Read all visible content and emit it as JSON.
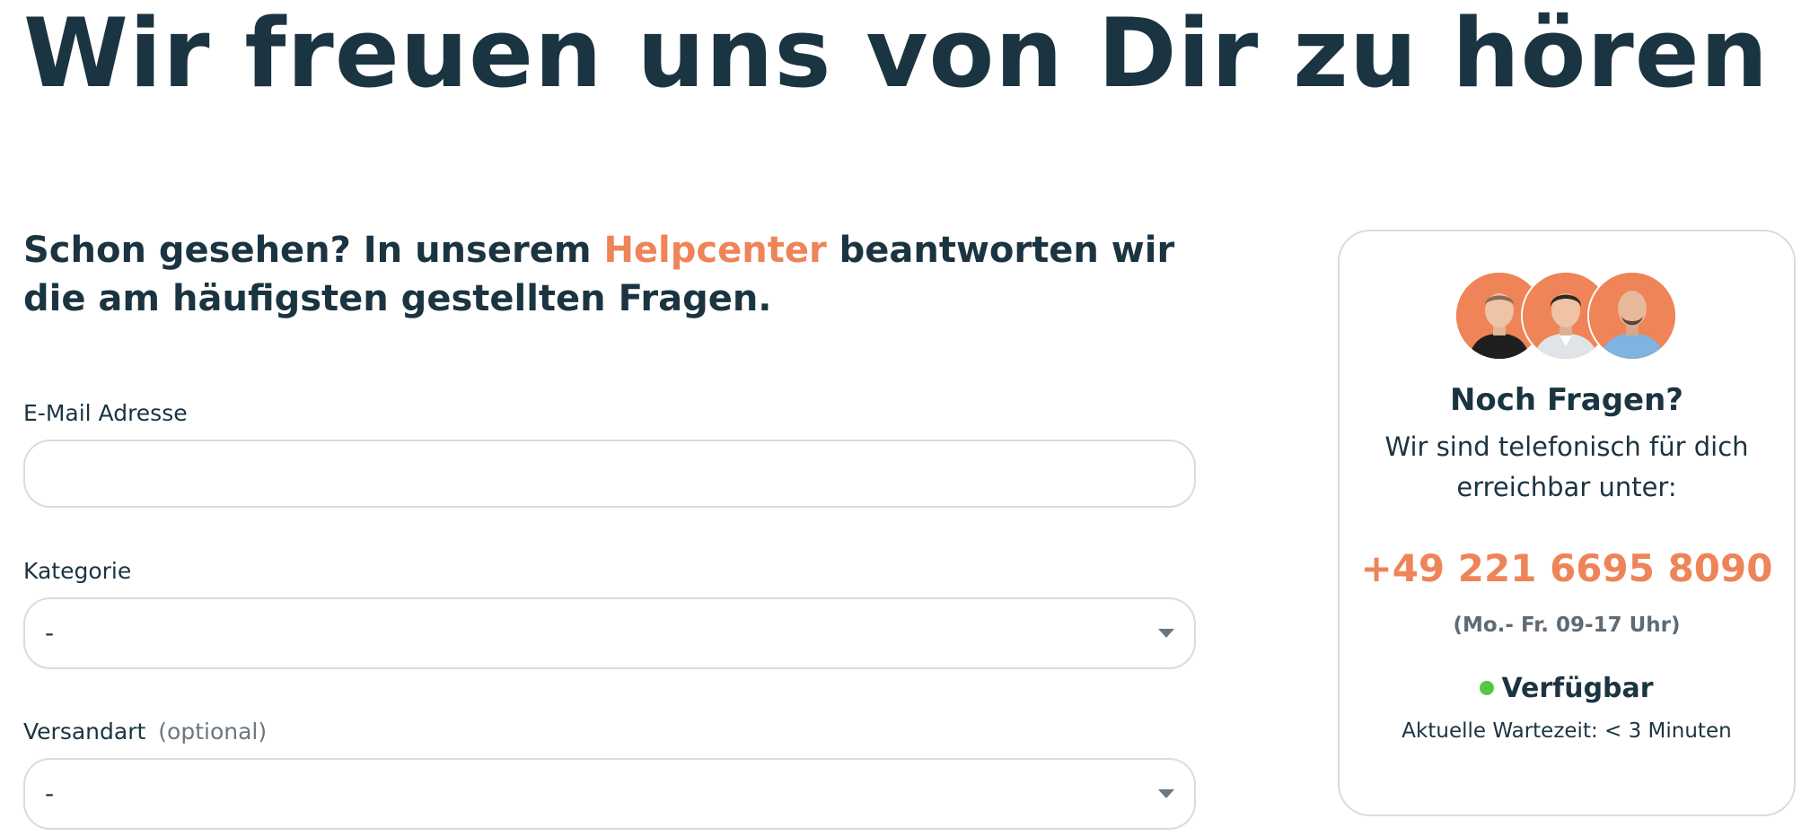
{
  "header": {
    "title": "Wir freuen uns von Dir zu hören"
  },
  "intro": {
    "before": "Schon gesehen? In unserem ",
    "link": "Helpcenter",
    "after": " beantworten wir die am häufigsten gestellten Fragen."
  },
  "form": {
    "email_label": "E-Mail Adresse",
    "email_value": "",
    "email_placeholder": "",
    "category_label": "Kategorie",
    "category_value": "-",
    "shipping_label": "Versandart",
    "shipping_optional": "(optional)",
    "shipping_value": "-"
  },
  "contact_card": {
    "title": "Noch Fragen?",
    "text": "Wir sind telefonisch für dich erreichbar unter:",
    "phone": "+49 221 6695 8090",
    "hours": "(Mo.- Fr. 09-17 Uhr)",
    "status": "Verfügbar",
    "wait_time": "Aktuelle Wartezeit: < 3 Minuten",
    "avatars": [
      "support-agent-1",
      "support-agent-2",
      "support-agent-3"
    ]
  },
  "colors": {
    "text": "#1b3441",
    "accent": "#ee8457",
    "muted": "#6b7780",
    "border": "#d9dcdf",
    "status_available": "#5ac445"
  }
}
